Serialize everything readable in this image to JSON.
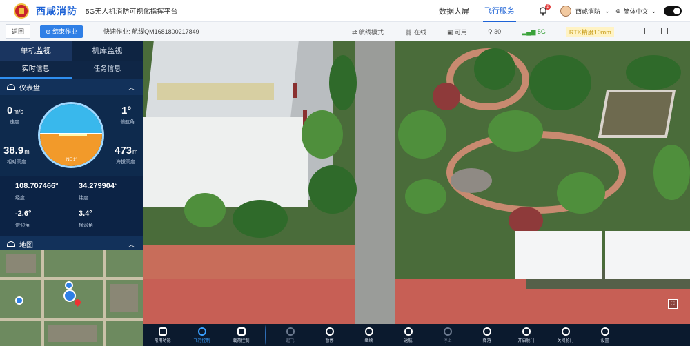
{
  "header": {
    "brand": "西咸消防",
    "subtitle": "5G无人机消防可视化指挥平台",
    "nav": [
      "数据大屏",
      "飞行服务"
    ],
    "notification_count": "2",
    "user_name": "西咸消防",
    "language": "简体中文"
  },
  "toolbar": {
    "back_label": "返回",
    "end_task_label": "结束作业",
    "task_info": "快速作业: 航线QM1681800217849",
    "items": [
      "航线模式",
      "在线",
      "可用",
      "30",
      "5G",
      "RTK精度10mm"
    ]
  },
  "left_panel": {
    "tabs": [
      "单机监视",
      "机库监视"
    ],
    "subtabs": [
      "实时信息",
      "任务信息"
    ],
    "dashboard_title": "仪表盘",
    "map_title": "地图",
    "speed": {
      "value": "0",
      "unit": "m/s",
      "label": "速度"
    },
    "yaw": {
      "value": "1°",
      "label": "偏航角"
    },
    "rel_alt": {
      "value": "38.9",
      "unit": "m",
      "label": "相对高度"
    },
    "abs_alt": {
      "value": "473",
      "unit": "m",
      "label": "海拔高度"
    },
    "heading_text": "NE 1°",
    "longitude": {
      "value": "108.707466°",
      "label": "经度"
    },
    "latitude": {
      "value": "34.279904°",
      "label": "纬度"
    },
    "pitch": {
      "value": "-2.6°",
      "label": "俯仰角"
    },
    "roll": {
      "value": "3.4°",
      "label": "横滚角"
    }
  },
  "controls": [
    {
      "label": "常用功能",
      "state": "normal"
    },
    {
      "label": "飞行控制",
      "state": "selected"
    },
    {
      "label": "载荷控制",
      "state": "normal"
    },
    {
      "label": "起飞",
      "state": "dim"
    },
    {
      "label": "暂停",
      "state": "normal"
    },
    {
      "label": "继续",
      "state": "normal"
    },
    {
      "label": "返航",
      "state": "normal"
    },
    {
      "label": "停止",
      "state": "dim"
    },
    {
      "label": "降落",
      "state": "normal"
    },
    {
      "label": "开启舱门",
      "state": "normal"
    },
    {
      "label": "关闭舱门",
      "state": "normal"
    },
    {
      "label": "设置",
      "state": "normal"
    }
  ]
}
